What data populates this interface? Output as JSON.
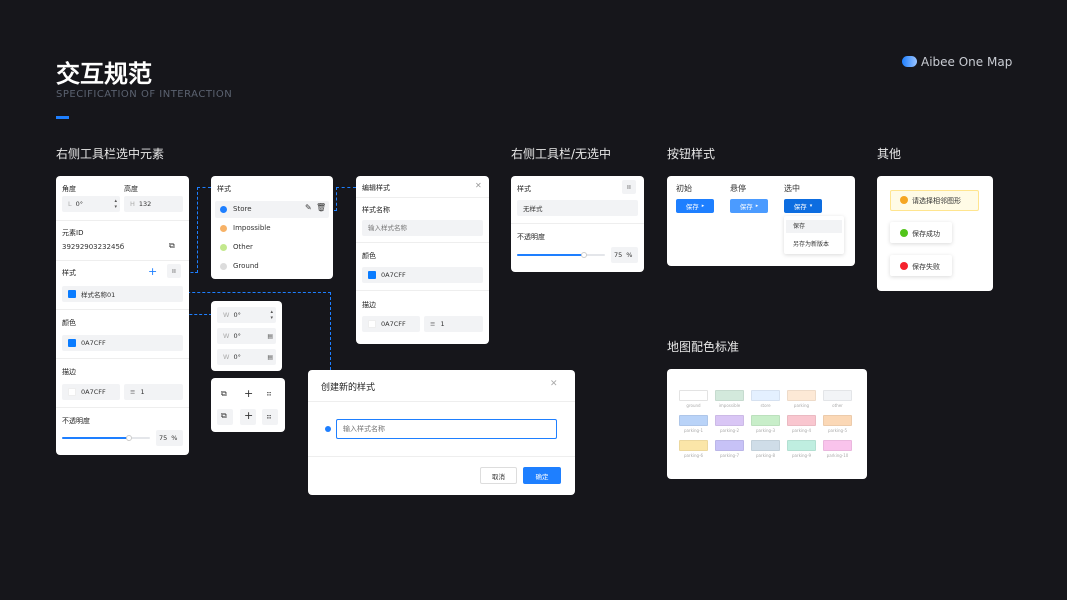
{
  "header": {
    "title": "交互规范",
    "subtitle": "SPECIFICATION OF INTERACTION",
    "brand": "Aibee One Map",
    "brand_icon": "aibee-logo-icon",
    "accent": "#1e7fff"
  },
  "sections": {
    "s1": "右侧工具栏选中元素",
    "s2": "右侧工具栏/无选中",
    "s3": "按钮样式",
    "s4": "其他",
    "s5": "地图配色标准"
  },
  "panel1": {
    "angle_label": "角度",
    "height_label": "高度",
    "angle_prefix": "L",
    "angle_value": "0°",
    "height_prefix": "H",
    "height_value": "132",
    "id_label": "元素ID",
    "id_value": "3929290323245б",
    "style_label": "样式",
    "style_value": "样式名称01",
    "color_label": "颜色",
    "color_value": "0A7CFF",
    "stroke_label": "描边",
    "stroke_color": "0A7CFF",
    "stroke_width": "1",
    "opacity_label": "不透明度",
    "opacity_value": "75",
    "opacity_unit": "%",
    "opacity_fraction": 0.75
  },
  "style_list": {
    "title": "样式",
    "items": [
      {
        "label": "Store",
        "color": "#1e7fff"
      },
      {
        "label": "Impossible",
        "color": "#f7b267"
      },
      {
        "label": "Other",
        "color": "#c3e88d"
      },
      {
        "label": "Ground",
        "color": "#dcdcdc"
      }
    ]
  },
  "edit_style": {
    "title": "编辑样式",
    "name_label": "样式名称",
    "name_placeholder": "输入样式名称",
    "color_label": "颜色",
    "color_value": "0A7CFF",
    "stroke_label": "描边",
    "stroke_color": "0A7CFF",
    "stroke_width": "1"
  },
  "angle_panel": {
    "rows": [
      {
        "prefix": "W",
        "value": "0°"
      },
      {
        "prefix": "W",
        "value": "0°"
      },
      {
        "prefix": "W",
        "value": "0°"
      }
    ]
  },
  "create_dialog": {
    "title": "创建新的样式",
    "placeholder": "输入样式名称",
    "cancel": "取消",
    "ok": "确定"
  },
  "panel2": {
    "style_label": "样式",
    "style_value": "无样式",
    "opacity_label": "不透明度",
    "opacity_value": "75",
    "opacity_unit": "%",
    "opacity_fraction": 0.75
  },
  "buttons": {
    "state1": "初始",
    "state2": "悬停",
    "state3": "选中",
    "save": "保存",
    "menu": [
      "保存",
      "另存为新版本"
    ]
  },
  "other": {
    "warn": "请选择相邻图形",
    "success": "保存成功",
    "fail": "保存失败",
    "warn_color": "#f5a623",
    "success_color": "#52c41a",
    "fail_color": "#f5222d"
  },
  "palette": [
    {
      "label": "ground",
      "color": "#ffffff"
    },
    {
      "label": "impossible",
      "color": "#d3e9dc"
    },
    {
      "label": "store",
      "color": "#e4f0ff"
    },
    {
      "label": "parking",
      "color": "#fde9d6"
    },
    {
      "label": "other",
      "color": "#f2f4f7"
    },
    {
      "label": "parking-1",
      "color": "#b9d3f8"
    },
    {
      "label": "parking-2",
      "color": "#d9c6f5"
    },
    {
      "label": "parking-3",
      "color": "#c8eec9"
    },
    {
      "label": "parking-4",
      "color": "#f9c6cf"
    },
    {
      "label": "parking-5",
      "color": "#fbd8b6"
    },
    {
      "label": "parking-6",
      "color": "#fbe6a8"
    },
    {
      "label": "parking-7",
      "color": "#c7c2f7"
    },
    {
      "label": "parking-8",
      "color": "#cfdde8"
    },
    {
      "label": "parking-9",
      "color": "#bfeee0"
    },
    {
      "label": "parking-10",
      "color": "#f9c3ec"
    }
  ]
}
